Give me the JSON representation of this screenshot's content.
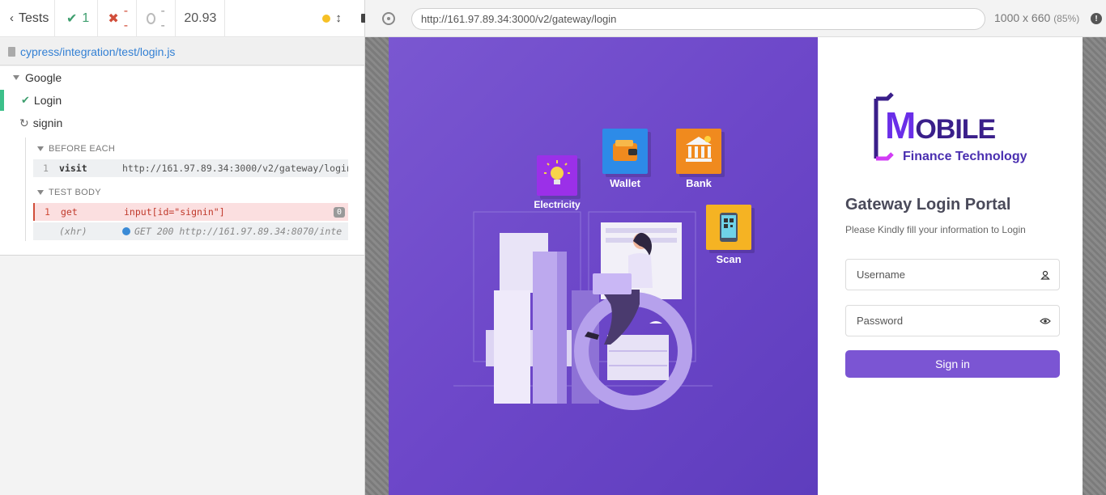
{
  "reporter": {
    "tests_label": "Tests",
    "passed": "1",
    "failed": "--",
    "pending": "--",
    "duration": "20.93",
    "spec_path": "cypress/integration/test/login.js",
    "suite": "Google",
    "tests": [
      {
        "title": "Login",
        "state": "passed"
      },
      {
        "title": "signin",
        "state": "running"
      }
    ],
    "before_each_label": "BEFORE EACH",
    "test_body_label": "TEST BODY",
    "commands": [
      {
        "num": "1",
        "name": "visit",
        "message": "http://161.97.89.34:3000/v2/gateway/login"
      },
      {
        "num": "1",
        "name": "get",
        "message": "input[id=\"signin\"]",
        "badge": "0"
      },
      {
        "num": "",
        "name": "(xhr)",
        "message": "GET 200 http://161.97.89.34:8070/inte"
      }
    ]
  },
  "aut": {
    "url": "http://161.97.89.34:3000/v2/gateway/login",
    "viewport": "1000 x 660",
    "zoom": "(85%)"
  },
  "app": {
    "services": [
      {
        "label": "Electricity",
        "icon": "lightbulb-icon",
        "color": "#9b30e8"
      },
      {
        "label": "Wallet",
        "icon": "wallet-icon",
        "color": "#2d8be8"
      },
      {
        "label": "Bank",
        "icon": "bank-icon",
        "color": "#f08a1e"
      },
      {
        "label": "Scan",
        "icon": "qr-scan-icon",
        "color": "#f5b323"
      }
    ],
    "logo": {
      "letter": "M",
      "word": "OBILE",
      "tagline": "Finance Technology"
    },
    "login": {
      "title": "Gateway Login Portal",
      "subtitle": "Please Kindly fill your information to Login",
      "username_placeholder": "Username",
      "password_placeholder": "Password",
      "signin_label": "Sign in"
    }
  },
  "colors": {
    "accent": "#7b55d3",
    "hero_start": "#7a57d1",
    "hero_end": "#5e3dbd",
    "pass": "#3e9e6e",
    "fail": "#d14e3a",
    "spec_link": "#3380d4"
  }
}
